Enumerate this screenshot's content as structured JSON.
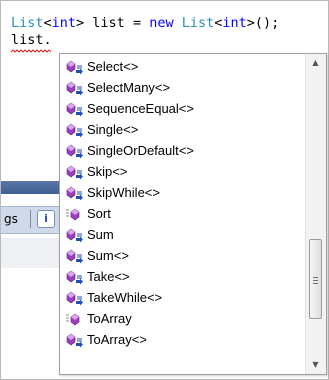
{
  "editor": {
    "line1": {
      "t1": "List",
      "t2": "<",
      "t3": "int",
      "t4": "> list = ",
      "t5": "new",
      "t6": " ",
      "t7": "List",
      "t8": "<",
      "t9": "int",
      "t10": ">();"
    },
    "line2": "list."
  },
  "background": {
    "tab_text": "gs",
    "info_glyph": "i"
  },
  "completion": {
    "items": [
      {
        "label": "Select<>",
        "icon": "extension-method-icon"
      },
      {
        "label": "SelectMany<>",
        "icon": "extension-method-icon"
      },
      {
        "label": "SequenceEqual<>",
        "icon": "extension-method-icon"
      },
      {
        "label": "Single<>",
        "icon": "extension-method-icon"
      },
      {
        "label": "SingleOrDefault<>",
        "icon": "extension-method-icon"
      },
      {
        "label": "Skip<>",
        "icon": "extension-method-icon"
      },
      {
        "label": "SkipWhile<>",
        "icon": "extension-method-icon"
      },
      {
        "label": "Sort",
        "icon": "method-icon"
      },
      {
        "label": "Sum",
        "icon": "extension-method-icon"
      },
      {
        "label": "Sum<>",
        "icon": "extension-method-icon"
      },
      {
        "label": "Take<>",
        "icon": "extension-method-icon"
      },
      {
        "label": "TakeWhile<>",
        "icon": "extension-method-icon"
      },
      {
        "label": "ToArray",
        "icon": "method-icon"
      },
      {
        "label": "ToArray<>",
        "icon": "extension-method-icon"
      }
    ],
    "scroll_position": 0.82,
    "scroll_thumb_fraction": 0.28,
    "colors": {
      "method_purple": "#9b3fc0",
      "extension_arrow_blue": "#1f4fbf"
    }
  }
}
